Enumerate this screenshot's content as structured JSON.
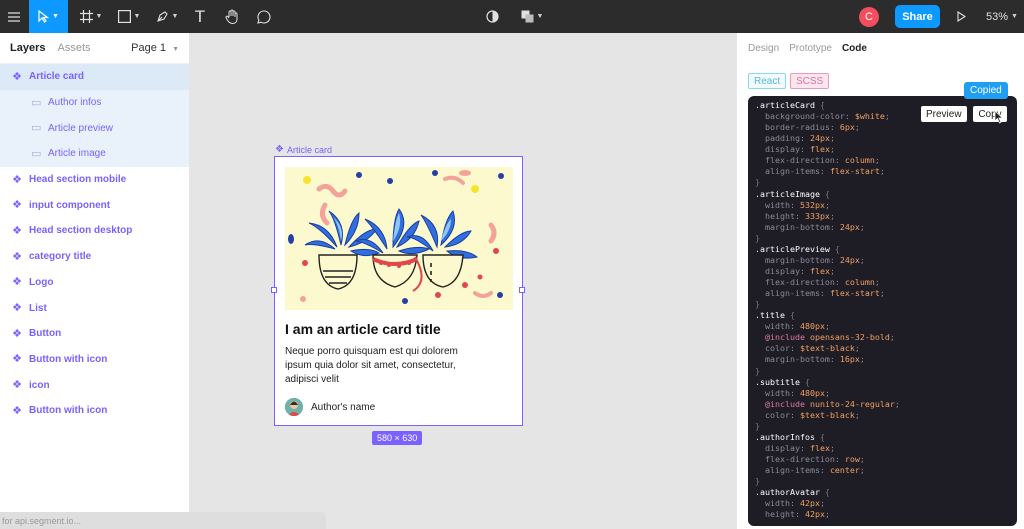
{
  "toolbar": {
    "menu_icon": "hamburger-icon",
    "move_tool_icon": "cursor-arrow-icon",
    "frame_tool_icon": "frame-hash-icon",
    "shape_tool_icon": "rectangle-icon",
    "pen_tool_icon": "pen-icon",
    "text_tool": "T",
    "hand_tool_icon": "hand-icon",
    "comment_tool_icon": "comment-bubble-icon",
    "mask_icon": "half-circle-icon",
    "boolean_icon": "boolean-squares-icon",
    "user_initial": "C",
    "share_label": "Share",
    "play_icon": "play-icon",
    "zoom": "53%",
    "accent": "#0d99ff"
  },
  "left_panel": {
    "tabs": [
      "Layers",
      "Assets"
    ],
    "page": "Page 1",
    "layers": [
      {
        "label": "Article card",
        "type": "component",
        "selected": true
      },
      {
        "label": "Author infos",
        "type": "child"
      },
      {
        "label": "Article preview",
        "type": "child"
      },
      {
        "label": "Article image",
        "type": "child"
      },
      {
        "label": "Head section mobile",
        "type": "component"
      },
      {
        "label": "input component",
        "type": "component"
      },
      {
        "label": "Head section desktop",
        "type": "component"
      },
      {
        "label": "category title",
        "type": "component"
      },
      {
        "label": "Logo",
        "type": "component"
      },
      {
        "label": "List",
        "type": "component"
      },
      {
        "label": "Button",
        "type": "component"
      },
      {
        "label": "Button with icon",
        "type": "component"
      },
      {
        "label": "icon",
        "type": "component"
      },
      {
        "label": "Button with icon",
        "type": "component"
      }
    ],
    "status_text": "for api.segment.io..."
  },
  "canvas": {
    "frame_label": "Article card",
    "card_title": "I am an article card title",
    "card_subtitle": "Neque porro quisquam est qui dolorem ipsum quia dolor sit amet, consectetur, adipisci velit",
    "author_name": "Author's name",
    "size_badge": "580 × 630",
    "selection_color": "#7b61ff"
  },
  "right_panel": {
    "tabs": [
      "Design",
      "Prototype",
      "Code"
    ],
    "active_tab": "Code",
    "lang_react": "React",
    "lang_scss": "SCSS",
    "copied_tooltip": "Copied",
    "preview_button": "Preview",
    "copy_button": "Copy",
    "code_lines": [
      [
        [
          "sel",
          ".articleCard"
        ],
        [
          "brace",
          " {"
        ]
      ],
      [
        [
          "prop",
          "  background-color: "
        ],
        [
          "val",
          "$white"
        ],
        [
          "prop",
          ";"
        ]
      ],
      [
        [
          "prop",
          "  border-radius: "
        ],
        [
          "val",
          "6px"
        ],
        [
          "prop",
          ";"
        ]
      ],
      [
        [
          "prop",
          "  padding: "
        ],
        [
          "val",
          "24px"
        ],
        [
          "prop",
          ";"
        ]
      ],
      [
        [
          "prop",
          "  display: "
        ],
        [
          "val",
          "flex"
        ],
        [
          "prop",
          ";"
        ]
      ],
      [
        [
          "prop",
          "  flex-direction: "
        ],
        [
          "val",
          "column"
        ],
        [
          "prop",
          ";"
        ]
      ],
      [
        [
          "prop",
          "  align-items: "
        ],
        [
          "val",
          "flex-start"
        ],
        [
          "prop",
          ";"
        ]
      ],
      [
        [
          "brace",
          "}"
        ]
      ],
      [
        [
          "sel",
          ".articleImage"
        ],
        [
          "brace",
          " {"
        ]
      ],
      [
        [
          "prop",
          "  width: "
        ],
        [
          "val",
          "532px"
        ],
        [
          "prop",
          ";"
        ]
      ],
      [
        [
          "prop",
          "  height: "
        ],
        [
          "val",
          "333px"
        ],
        [
          "prop",
          ";"
        ]
      ],
      [
        [
          "prop",
          "  margin-bottom: "
        ],
        [
          "val",
          "24px"
        ],
        [
          "prop",
          ";"
        ]
      ],
      [
        [
          "brace",
          "}"
        ]
      ],
      [
        [
          "sel",
          ".articlePreview"
        ],
        [
          "brace",
          " {"
        ]
      ],
      [
        [
          "prop",
          "  margin-bottom: "
        ],
        [
          "val",
          "24px"
        ],
        [
          "prop",
          ";"
        ]
      ],
      [
        [
          "prop",
          "  display: "
        ],
        [
          "val",
          "flex"
        ],
        [
          "prop",
          ";"
        ]
      ],
      [
        [
          "prop",
          "  flex-direction: "
        ],
        [
          "val",
          "column"
        ],
        [
          "prop",
          ";"
        ]
      ],
      [
        [
          "prop",
          "  align-items: "
        ],
        [
          "val",
          "flex-start"
        ],
        [
          "prop",
          ";"
        ]
      ],
      [
        [
          "brace",
          "}"
        ]
      ],
      [
        [
          "sel",
          ".title"
        ],
        [
          "brace",
          " {"
        ]
      ],
      [
        [
          "prop",
          "  width: "
        ],
        [
          "val",
          "480px"
        ],
        [
          "prop",
          ";"
        ]
      ],
      [
        [
          "inc",
          "  @include "
        ],
        [
          "val",
          "opensans-32-bold"
        ],
        [
          "prop",
          ";"
        ]
      ],
      [
        [
          "prop",
          "  color: "
        ],
        [
          "val",
          "$text-black"
        ],
        [
          "prop",
          ";"
        ]
      ],
      [
        [
          "prop",
          "  margin-bottom: "
        ],
        [
          "val",
          "16px"
        ],
        [
          "prop",
          ";"
        ]
      ],
      [
        [
          "brace",
          "}"
        ]
      ],
      [
        [
          "sel",
          ".subtitle"
        ],
        [
          "brace",
          " {"
        ]
      ],
      [
        [
          "prop",
          "  width: "
        ],
        [
          "val",
          "480px"
        ],
        [
          "prop",
          ";"
        ]
      ],
      [
        [
          "inc",
          "  @include "
        ],
        [
          "val",
          "nunito-24-regular"
        ],
        [
          "prop",
          ";"
        ]
      ],
      [
        [
          "prop",
          "  color: "
        ],
        [
          "val",
          "$text-black"
        ],
        [
          "prop",
          ";"
        ]
      ],
      [
        [
          "brace",
          "}"
        ]
      ],
      [
        [
          "sel",
          ".authorInfos"
        ],
        [
          "brace",
          " {"
        ]
      ],
      [
        [
          "prop",
          "  display: "
        ],
        [
          "val",
          "flex"
        ],
        [
          "prop",
          ";"
        ]
      ],
      [
        [
          "prop",
          "  flex-direction: "
        ],
        [
          "val",
          "row"
        ],
        [
          "prop",
          ";"
        ]
      ],
      [
        [
          "prop",
          "  align-items: "
        ],
        [
          "val",
          "center"
        ],
        [
          "prop",
          ";"
        ]
      ],
      [
        [
          "brace",
          "}"
        ]
      ],
      [
        [
          "sel",
          ".authorAvatar"
        ],
        [
          "brace",
          " {"
        ]
      ],
      [
        [
          "prop",
          "  width: "
        ],
        [
          "val",
          "42px"
        ],
        [
          "prop",
          ";"
        ]
      ],
      [
        [
          "prop",
          "  height: "
        ],
        [
          "val",
          "42px"
        ],
        [
          "prop",
          ";"
        ]
      ]
    ]
  }
}
